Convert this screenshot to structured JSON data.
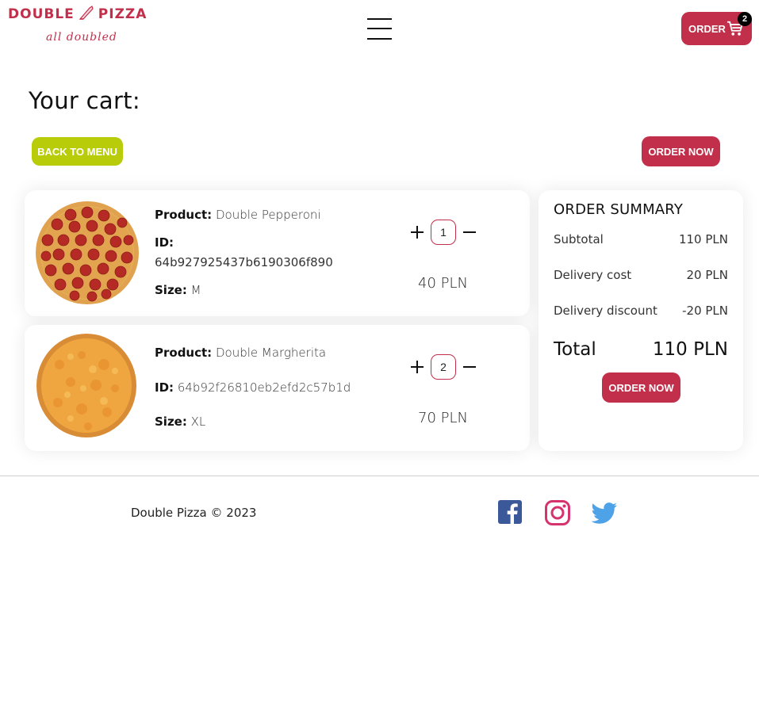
{
  "header": {
    "logo_title_left": "DOUBLE",
    "logo_title_right": "PIZZA",
    "logo_tagline": "all doubled",
    "order_button_label": "ORDER",
    "cart_count": "2"
  },
  "page": {
    "title": "Your cart:",
    "back_button": "BACK TO MENU",
    "order_now_button": "ORDER NOW"
  },
  "cart": {
    "items": [
      {
        "product_label": "Product:",
        "product": "Double Pepperoni",
        "id_label": "ID:",
        "id": "64b927925437b6190306f890",
        "size_label": "Size:",
        "size": "M",
        "quantity": "1",
        "price": "40 PLN"
      },
      {
        "product_label": "Product:",
        "product": "Double Margherita",
        "id_label": "ID:",
        "id": "64b92f26810eb2efd2c57b1d",
        "size_label": "Size:",
        "size": "XL",
        "quantity": "2",
        "price": "70 PLN"
      }
    ]
  },
  "summary": {
    "title": "ORDER SUMMARY",
    "rows": [
      {
        "label": "Subtotal",
        "value": "110 PLN"
      },
      {
        "label": "Delivery cost",
        "value": "20 PLN"
      },
      {
        "label": "Delivery discount",
        "value": "-20 PLN"
      }
    ],
    "total_label": "Total",
    "total_value": "110 PLN",
    "order_button": "ORDER NOW"
  },
  "footer": {
    "copyright": "Double Pizza © 2023",
    "social": [
      "facebook-icon",
      "instagram-icon",
      "twitter-icon"
    ]
  },
  "colors": {
    "brand_red": "#c22f4a",
    "back_green": "#b8cc0a",
    "facebook": "#3b5998",
    "instagram": "#d6336c",
    "twitter": "#4ea3e8"
  }
}
